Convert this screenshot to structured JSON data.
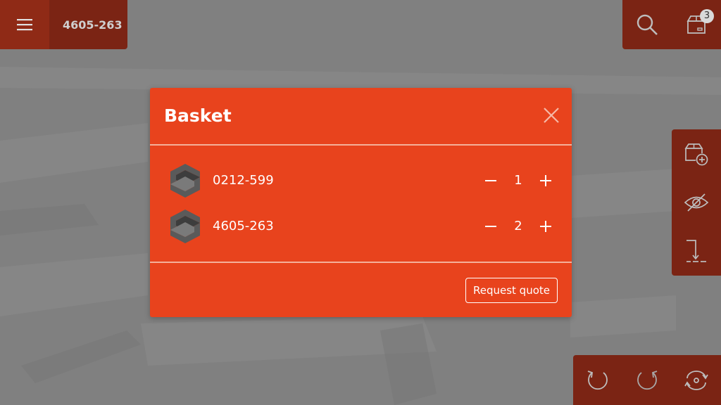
{
  "header": {
    "title": "4605-263",
    "basket_count": "3"
  },
  "icons": {
    "menu": "hamburger-menu-icon",
    "search": "search-icon",
    "basket": "basket-box-icon",
    "add_to_basket": "add-box-icon",
    "visibility": "eye-slash-icon",
    "drop": "drop-down-icon",
    "undo": "undo-icon",
    "redo": "redo-icon",
    "reset_view": "rotate-view-icon",
    "close": "close-icon",
    "minus": "minus-icon",
    "plus": "plus-icon"
  },
  "basket_modal": {
    "title": "Basket",
    "items": [
      {
        "part": "0212-599",
        "quantity": "1"
      },
      {
        "part": "4605-263",
        "quantity": "2"
      }
    ],
    "request_quote_label": "Request quote"
  },
  "colors": {
    "accent": "#e8431d",
    "toolbar": "#7b2414",
    "overlay": "#808080"
  }
}
